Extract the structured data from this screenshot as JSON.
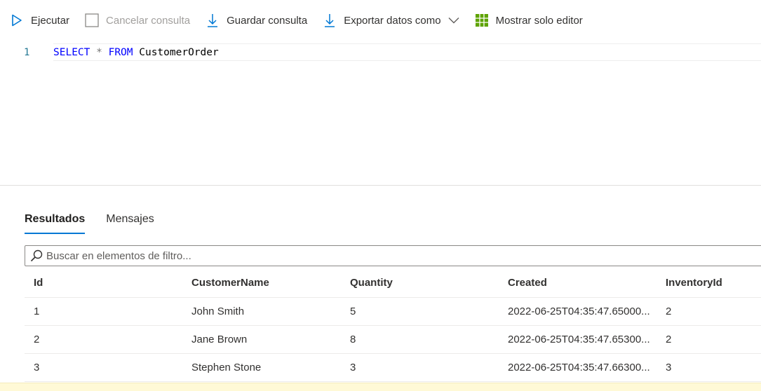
{
  "toolbar": {
    "run_label": "Ejecutar",
    "cancel_label": "Cancelar consulta",
    "save_label": "Guardar consulta",
    "export_label": "Exportar datos como",
    "editor_only_label": "Mostrar solo editor",
    "icons": {
      "run": "play-icon",
      "cancel": "stop-icon",
      "save": "download-icon",
      "export": "download-icon",
      "export_menu": "chevron-down-icon",
      "editor_only": "grid-icon"
    },
    "colors": {
      "accent": "#0078d4",
      "grid_icon": "#6bb700"
    }
  },
  "editor": {
    "line_number": "1",
    "tokens": {
      "select": "SELECT",
      "star": " * ",
      "from": "FROM",
      "table": " CustomerOrder"
    }
  },
  "results": {
    "tabs": [
      {
        "label": "Resultados",
        "active": true
      },
      {
        "label": "Mensajes",
        "active": false
      }
    ],
    "filter_placeholder": "Buscar en elementos de filtro...",
    "columns": [
      "Id",
      "CustomerName",
      "Quantity",
      "Created",
      "InventoryId"
    ],
    "rows": [
      [
        "1",
        "John Smith",
        "5",
        "2022-06-25T04:35:47.65000...",
        "2"
      ],
      [
        "2",
        "Jane Brown",
        "8",
        "2022-06-25T04:35:47.65300...",
        "2"
      ],
      [
        "3",
        "Stephen Stone",
        "3",
        "2022-06-25T04:35:47.66300...",
        "3"
      ]
    ]
  }
}
